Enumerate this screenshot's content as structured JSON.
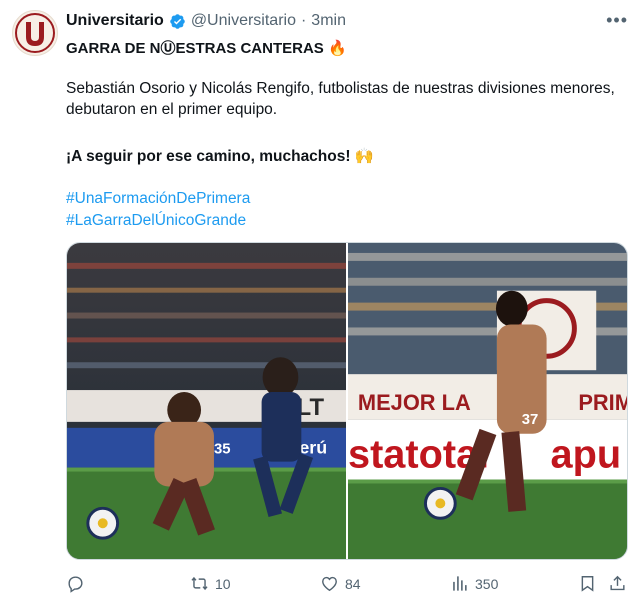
{
  "account": {
    "display_name": "Universitario",
    "handle": "@Universitario",
    "separator": "·",
    "time": "3min",
    "avatar_letter": "U"
  },
  "tweet": {
    "headline": "GARRA DE NⓊESTRAS CANTERAS",
    "headline_emoji": "🔥",
    "body": "Sebastián Osorio y Nicolás Rengifo, futbolistas de nuestras divisiones menores, debutaron en el primer equipo.",
    "cheer": "¡A seguir por ese camino, muchachos!",
    "cheer_emoji": "🙌",
    "hashtags": [
      "#UnaFormaciónDePrimera",
      "#LaGarraDelÚnicoGrande"
    ]
  },
  "media": {
    "left": {
      "shirt_number": "35",
      "banner_text": "ALT",
      "sponsor_text": "Perú"
    },
    "right": {
      "shirt_number": "37",
      "banner_text": "MEJOR LA",
      "banner_text_2": "PRIM",
      "sponsor_text": "statotal",
      "sponsor_text_2": "apu"
    }
  },
  "actions": {
    "reply_count": "",
    "retweet_count": "10",
    "like_count": "84",
    "views_count": "350"
  },
  "colors": {
    "link": "#1d9bf0",
    "muted": "#536471",
    "brand": "#9b1b1f"
  }
}
